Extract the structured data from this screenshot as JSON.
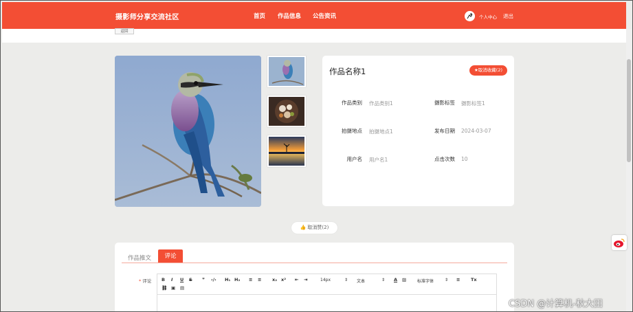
{
  "nav": {
    "brand": "摄影师分享交流社区",
    "links": [
      "首页",
      "作品信息",
      "公告资讯"
    ],
    "user_center": "个人中心",
    "logout": "退出"
  },
  "back_label": "返回",
  "product": {
    "title": "作品名称1",
    "favorite_button": "取消收藏(2)",
    "fields": [
      {
        "label": "作品类别",
        "value": "作品类别1"
      },
      {
        "label": "摄影标签",
        "value": "摄影标签1"
      },
      {
        "label": "拍摄地点",
        "value": "拍摄地点1"
      },
      {
        "label": "发布日期",
        "value": "2024-03-07"
      },
      {
        "label": "用户名",
        "value": "用户名1"
      },
      {
        "label": "点击次数",
        "value": "10"
      }
    ]
  },
  "like_button": "取消赞(2)",
  "tabs": [
    "作品推文",
    "评论"
  ],
  "comment": {
    "required_mark": "*",
    "label": "评论",
    "toolbar": [
      "B",
      "I",
      "U",
      "S",
      "❞",
      "‹/›",
      "H₁",
      "H₂",
      "≡",
      "≡",
      "x₂",
      "x²",
      "⇤",
      "⇥",
      "14px",
      "文本",
      "A",
      "▨",
      "标准字体",
      "≡",
      "Tx",
      "⛓",
      "▣",
      "▤"
    ]
  },
  "watermark": "CSDN @计算机-秋大田",
  "colors": {
    "accent": "#f34e34"
  }
}
